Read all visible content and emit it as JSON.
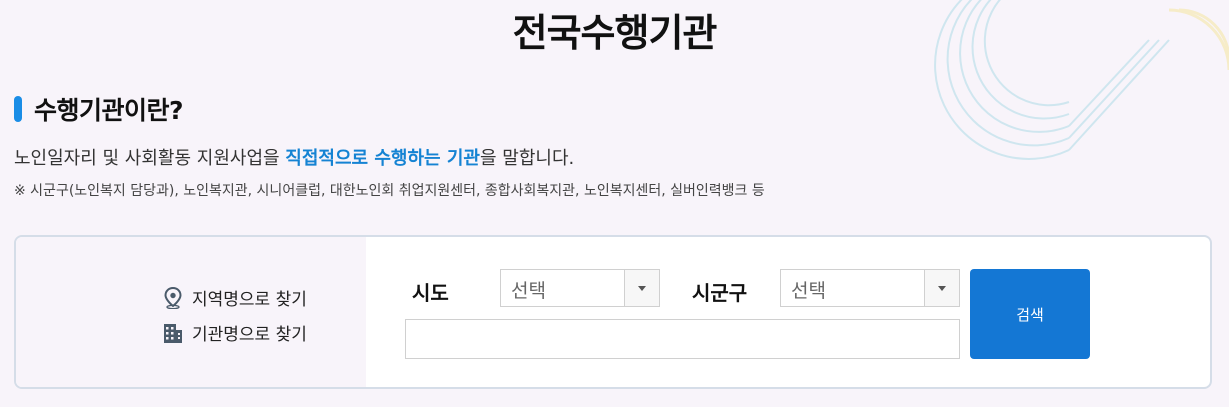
{
  "page": {
    "title": "전국수행기관"
  },
  "section": {
    "heading": "수행기관이란?",
    "desc_before": "노인일자리 및 사회활동 지원사업을 ",
    "desc_highlight": "직접적으로 수행하는 기관",
    "desc_after": "을 말합니다.",
    "note": "※ 시군구(노인복지 담당과), 노인복지관, 시니어클럽, 대한노인회 취업지원센터, 종합사회복지관, 노인복지센터, 실버인력뱅크 등"
  },
  "search": {
    "mode_region": "지역명으로 찾기",
    "mode_region_icon": "location-pin-icon",
    "mode_name": "기관명으로 찾기",
    "mode_name_icon": "building-icon",
    "sido_label": "시도",
    "sido_value": "선택",
    "sigungu_label": "시군구",
    "sigungu_value": "선택",
    "name_value": "",
    "button_label": "검색"
  },
  "colors": {
    "accent": "#1a8de6",
    "highlight": "#1583d3",
    "button": "#1477d4",
    "background": "#f8f4fa"
  }
}
